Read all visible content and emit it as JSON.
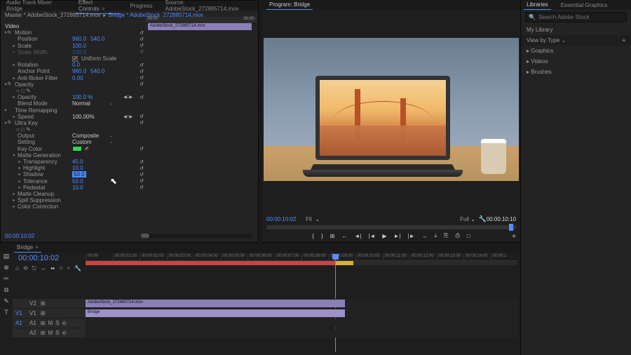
{
  "tabs_tl_source": {
    "audio_mixer": "Audio Track Mixer: Bridge",
    "effect_controls": "Effect Controls",
    "progress": "Progress",
    "source": "Source: AdobeStock_272885714.mov"
  },
  "ec": {
    "master": "Master * AdobeStock_272885714.mov",
    "seq_link": "Bridge * AdobeStock_272885714.mov",
    "ruler_start": ":00:00",
    "ruler_end": "00:00:",
    "clip_name": "AdobeStock_272885714.mov",
    "section_video": "Video",
    "motion": {
      "label": "Motion",
      "position": "Position",
      "px": "960.0",
      "py": "540.0",
      "scale": "Scale",
      "scale_v": "100.0",
      "scale_w": "Scale Width",
      "scale_w_v": "100.0",
      "uniform": "Uniform Scale",
      "rotation": "Rotation",
      "rotation_v": "0.0",
      "anchor": "Anchor Point",
      "ax": "960.0",
      "ay": "540.0",
      "antiflicker": "Anti-flicker Filter",
      "antiflicker_v": "0.00"
    },
    "opacity": {
      "label": "Opacity",
      "sub": "Opacity",
      "value": "100.0 %",
      "blend": "Blend Mode",
      "blend_v": "Normal"
    },
    "time": {
      "label": "Time Remapping",
      "speed": "Speed",
      "speed_v": "100.00%"
    },
    "ultra": {
      "label": "Ultra Key",
      "output": "Output",
      "output_v": "Composite",
      "setting": "Setting",
      "setting_v": "Custom",
      "key": "Key Color",
      "matte_gen": "Matte Generation",
      "transparency": "Transparency",
      "transparency_v": "45.0",
      "highlight": "Highlight",
      "highlight_v": "10.0",
      "shadow": "Shadow",
      "shadow_v": "50.0",
      "tolerance": "Tolerance",
      "tolerance_v": "50.0",
      "pedestal": "Pedestal",
      "pedestal_v": "10.0",
      "cleanup": "Matte Cleanup",
      "spill": "Spill Suppression",
      "color_corr": "Color Correction"
    },
    "tc": "00:00:10:02"
  },
  "program": {
    "tab": "Program: Bridge",
    "tc": "00:00:10:02",
    "fit": "Fit",
    "quality": "Full",
    "duration": "00:00:10:10",
    "transport": [
      "{",
      "}",
      "⊞",
      "←",
      "◄|",
      "|◄",
      "▶",
      "►|",
      "|►",
      "→",
      "⤓",
      "⎘",
      "⎙",
      "□"
    ]
  },
  "libs": {
    "tab1": "Libraries",
    "tab2": "Essential Graphics",
    "search_ph": "Search Adobe Stock",
    "my": "My Library",
    "view": "View by Type",
    "cats": [
      "Graphics",
      "Videos",
      "Brushes"
    ]
  },
  "timeline": {
    "tab": "Bridge",
    "tc": "00:00:10:02",
    "ticks": [
      "00:00",
      "00:00:01:00",
      "00:00:02:00",
      "00:00:03:00",
      "00:00:04:00",
      "00:00:05:00",
      "00:00:06:00",
      "00:00:07:00",
      "00:00:08:00",
      "00:00:09:00",
      "00:00:10:00",
      "00:00:11:00",
      "00:00:12:00",
      "00:00:13:00",
      "00:00:14:00",
      "00:00:1"
    ],
    "tools": [
      "▤",
      "⊕",
      "✂",
      "⧉",
      "✎",
      "T"
    ],
    "opts": [
      "⌂",
      "⟲",
      "⎋",
      "↔",
      "⬌",
      "⑁",
      "⑂",
      "🔧"
    ],
    "v2": {
      "name": "V2",
      "clip": "AdobeStock_272885714.mov",
      "tog": "⊞"
    },
    "v1": {
      "name": "V1",
      "clip": "Bridge",
      "tog": "⊞"
    },
    "a1": {
      "name": "A1",
      "tog": [
        "⊞",
        "M",
        "S",
        "⎆"
      ]
    },
    "a2": {
      "name": "A2",
      "tog": [
        "⊞",
        "M",
        "S",
        "⎆"
      ]
    },
    "trk_pre": {
      "v1": "V1",
      "a1": "A1"
    }
  }
}
